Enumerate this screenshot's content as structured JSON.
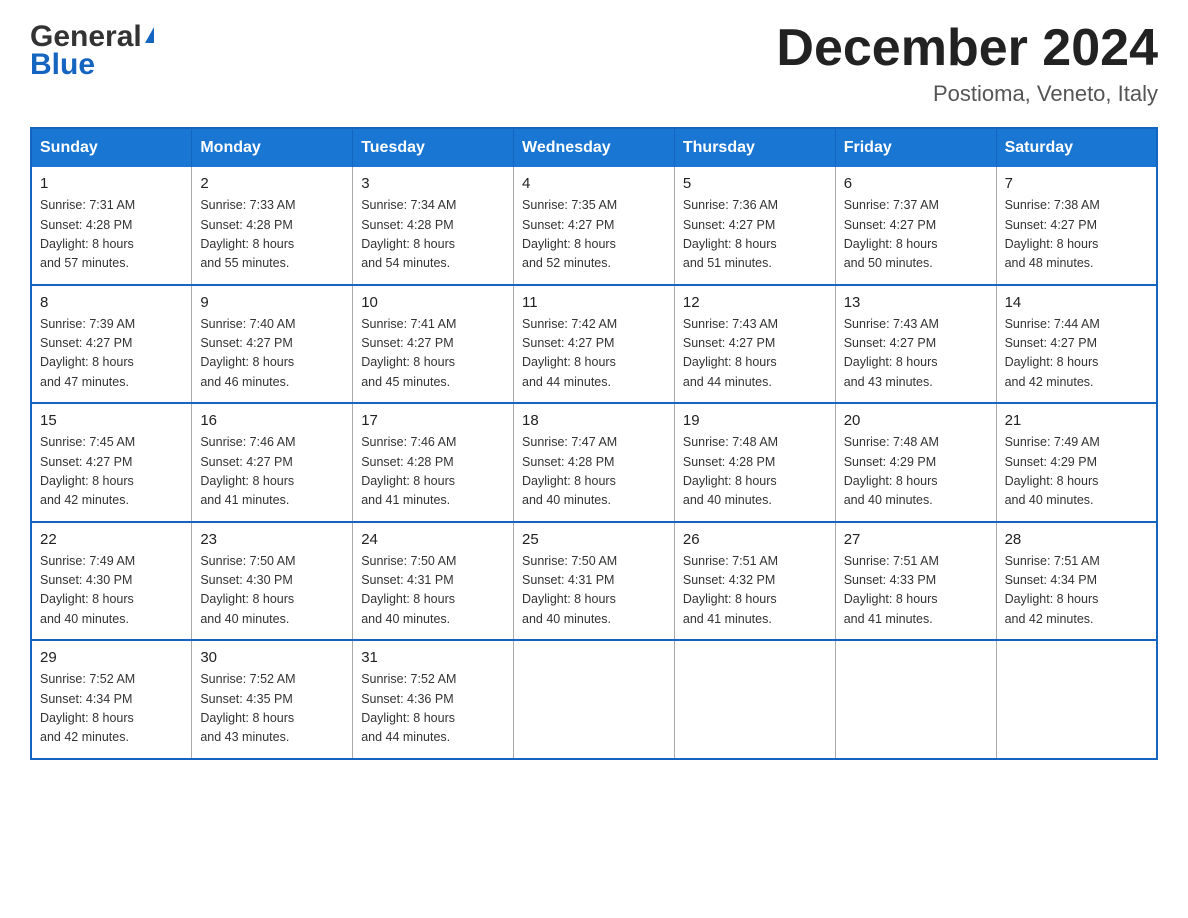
{
  "header": {
    "logo_general": "General",
    "logo_blue": "Blue",
    "month_year": "December 2024",
    "location": "Postioma, Veneto, Italy"
  },
  "days_of_week": [
    "Sunday",
    "Monday",
    "Tuesday",
    "Wednesday",
    "Thursday",
    "Friday",
    "Saturday"
  ],
  "weeks": [
    [
      {
        "day": "1",
        "sunrise": "7:31 AM",
        "sunset": "4:28 PM",
        "daylight": "8 hours and 57 minutes."
      },
      {
        "day": "2",
        "sunrise": "7:33 AM",
        "sunset": "4:28 PM",
        "daylight": "8 hours and 55 minutes."
      },
      {
        "day": "3",
        "sunrise": "7:34 AM",
        "sunset": "4:28 PM",
        "daylight": "8 hours and 54 minutes."
      },
      {
        "day": "4",
        "sunrise": "7:35 AM",
        "sunset": "4:27 PM",
        "daylight": "8 hours and 52 minutes."
      },
      {
        "day": "5",
        "sunrise": "7:36 AM",
        "sunset": "4:27 PM",
        "daylight": "8 hours and 51 minutes."
      },
      {
        "day": "6",
        "sunrise": "7:37 AM",
        "sunset": "4:27 PM",
        "daylight": "8 hours and 50 minutes."
      },
      {
        "day": "7",
        "sunrise": "7:38 AM",
        "sunset": "4:27 PM",
        "daylight": "8 hours and 48 minutes."
      }
    ],
    [
      {
        "day": "8",
        "sunrise": "7:39 AM",
        "sunset": "4:27 PM",
        "daylight": "8 hours and 47 minutes."
      },
      {
        "day": "9",
        "sunrise": "7:40 AM",
        "sunset": "4:27 PM",
        "daylight": "8 hours and 46 minutes."
      },
      {
        "day": "10",
        "sunrise": "7:41 AM",
        "sunset": "4:27 PM",
        "daylight": "8 hours and 45 minutes."
      },
      {
        "day": "11",
        "sunrise": "7:42 AM",
        "sunset": "4:27 PM",
        "daylight": "8 hours and 44 minutes."
      },
      {
        "day": "12",
        "sunrise": "7:43 AM",
        "sunset": "4:27 PM",
        "daylight": "8 hours and 44 minutes."
      },
      {
        "day": "13",
        "sunrise": "7:43 AM",
        "sunset": "4:27 PM",
        "daylight": "8 hours and 43 minutes."
      },
      {
        "day": "14",
        "sunrise": "7:44 AM",
        "sunset": "4:27 PM",
        "daylight": "8 hours and 42 minutes."
      }
    ],
    [
      {
        "day": "15",
        "sunrise": "7:45 AM",
        "sunset": "4:27 PM",
        "daylight": "8 hours and 42 minutes."
      },
      {
        "day": "16",
        "sunrise": "7:46 AM",
        "sunset": "4:27 PM",
        "daylight": "8 hours and 41 minutes."
      },
      {
        "day": "17",
        "sunrise": "7:46 AM",
        "sunset": "4:28 PM",
        "daylight": "8 hours and 41 minutes."
      },
      {
        "day": "18",
        "sunrise": "7:47 AM",
        "sunset": "4:28 PM",
        "daylight": "8 hours and 40 minutes."
      },
      {
        "day": "19",
        "sunrise": "7:48 AM",
        "sunset": "4:28 PM",
        "daylight": "8 hours and 40 minutes."
      },
      {
        "day": "20",
        "sunrise": "7:48 AM",
        "sunset": "4:29 PM",
        "daylight": "8 hours and 40 minutes."
      },
      {
        "day": "21",
        "sunrise": "7:49 AM",
        "sunset": "4:29 PM",
        "daylight": "8 hours and 40 minutes."
      }
    ],
    [
      {
        "day": "22",
        "sunrise": "7:49 AM",
        "sunset": "4:30 PM",
        "daylight": "8 hours and 40 minutes."
      },
      {
        "day": "23",
        "sunrise": "7:50 AM",
        "sunset": "4:30 PM",
        "daylight": "8 hours and 40 minutes."
      },
      {
        "day": "24",
        "sunrise": "7:50 AM",
        "sunset": "4:31 PM",
        "daylight": "8 hours and 40 minutes."
      },
      {
        "day": "25",
        "sunrise": "7:50 AM",
        "sunset": "4:31 PM",
        "daylight": "8 hours and 40 minutes."
      },
      {
        "day": "26",
        "sunrise": "7:51 AM",
        "sunset": "4:32 PM",
        "daylight": "8 hours and 41 minutes."
      },
      {
        "day": "27",
        "sunrise": "7:51 AM",
        "sunset": "4:33 PM",
        "daylight": "8 hours and 41 minutes."
      },
      {
        "day": "28",
        "sunrise": "7:51 AM",
        "sunset": "4:34 PM",
        "daylight": "8 hours and 42 minutes."
      }
    ],
    [
      {
        "day": "29",
        "sunrise": "7:52 AM",
        "sunset": "4:34 PM",
        "daylight": "8 hours and 42 minutes."
      },
      {
        "day": "30",
        "sunrise": "7:52 AM",
        "sunset": "4:35 PM",
        "daylight": "8 hours and 43 minutes."
      },
      {
        "day": "31",
        "sunrise": "7:52 AM",
        "sunset": "4:36 PM",
        "daylight": "8 hours and 44 minutes."
      },
      null,
      null,
      null,
      null
    ]
  ],
  "labels": {
    "sunrise": "Sunrise:",
    "sunset": "Sunset:",
    "daylight": "Daylight:"
  }
}
